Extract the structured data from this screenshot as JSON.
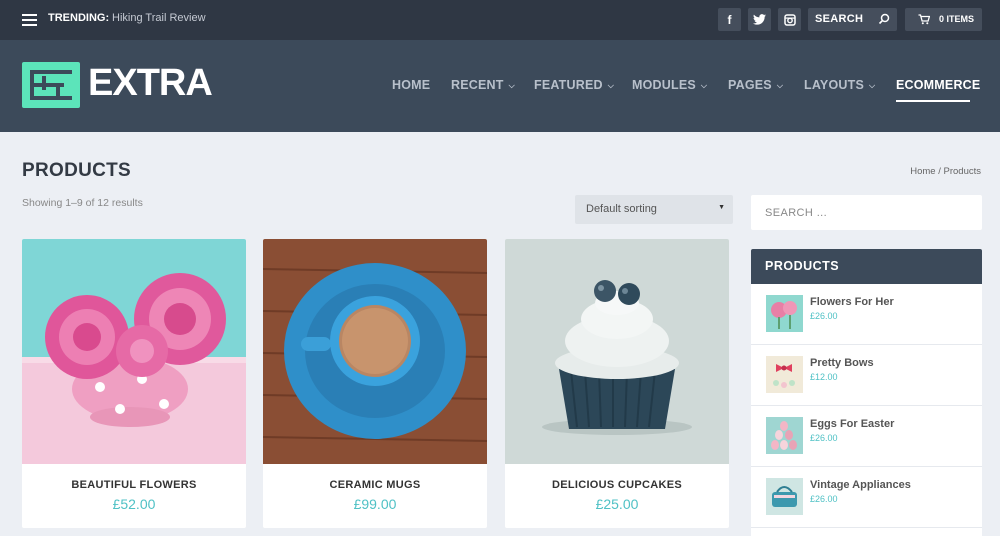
{
  "topbar": {
    "trending_label": "TRENDING:",
    "trending_item": "Hiking Trail Review",
    "social": [
      "facebook-icon",
      "twitter-icon",
      "instagram-icon"
    ],
    "search_label": "SEARCH",
    "cart_label": "0 ITEMS"
  },
  "logo": {
    "text": "EXTRA",
    "accent": "#5ce4ba"
  },
  "nav": [
    {
      "label": "HOME",
      "dropdown": false
    },
    {
      "label": "RECENT",
      "dropdown": true
    },
    {
      "label": "FEATURED",
      "dropdown": true
    },
    {
      "label": "MODULES",
      "dropdown": true
    },
    {
      "label": "PAGES",
      "dropdown": true
    },
    {
      "label": "LAYOUTS",
      "dropdown": true
    },
    {
      "label": "ECOMMERCE",
      "dropdown": false,
      "active": true
    }
  ],
  "main": {
    "title": "PRODUCTS",
    "breadcrumb": "Home / Products",
    "result_count": "Showing 1–9 of 12 results",
    "sort_value": "Default sorting"
  },
  "products": [
    {
      "name": "BEAUTIFUL FLOWERS",
      "price": "£52.00"
    },
    {
      "name": "CERAMIC MUGS",
      "price": "£99.00"
    },
    {
      "name": "DELICIOUS CUPCAKES",
      "price": "£25.00"
    }
  ],
  "sidebar": {
    "search_placeholder": "SEARCH ...",
    "widget_title": "PRODUCTS",
    "items": [
      {
        "title": "Flowers For Her",
        "price": "£26.00"
      },
      {
        "title": "Pretty Bows",
        "price": "£12.00"
      },
      {
        "title": "Eggs For Easter",
        "price": "£26.00"
      },
      {
        "title": "Vintage Appliances",
        "price": "£26.00"
      }
    ]
  },
  "colors": {
    "topbar": "#2f3744",
    "header": "#3c4a5a",
    "price": "#4fc1c5",
    "background": "#eceff4"
  }
}
